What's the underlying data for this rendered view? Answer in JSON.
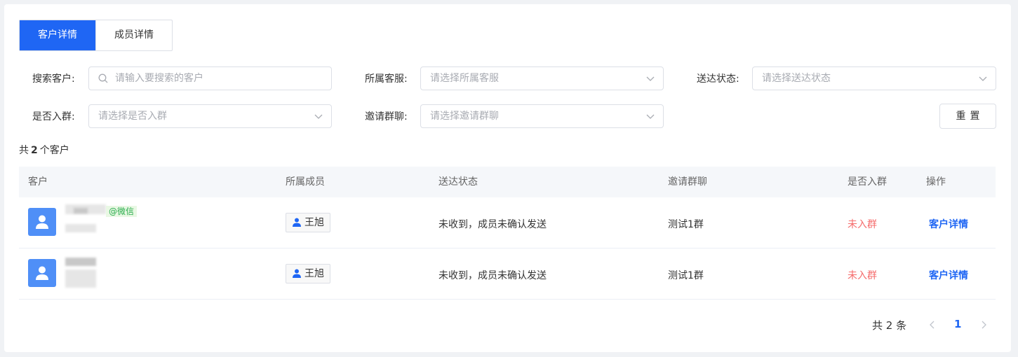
{
  "tabs": [
    {
      "label": "客户详情",
      "active": true
    },
    {
      "label": "成员详情",
      "active": false
    }
  ],
  "filters": {
    "search_customer": {
      "label": "搜索客户:",
      "placeholder": "请输入要搜索的客户"
    },
    "service_staff": {
      "label": "所属客服:",
      "placeholder": "请选择所属客服"
    },
    "delivery_status": {
      "label": "送达状态:",
      "placeholder": "请选择送达状态"
    },
    "joined_group": {
      "label": "是否入群:",
      "placeholder": "请选择是否入群"
    },
    "invite_group": {
      "label": "邀请群聊:",
      "placeholder": "请选择邀请群聊"
    },
    "reset_label": "重置"
  },
  "summary": {
    "prefix": "共",
    "count": "2",
    "suffix": "个客户"
  },
  "table": {
    "columns": [
      "客户",
      "所属成员",
      "送达状态",
      "邀请群聊",
      "是否入群",
      "操作"
    ],
    "rows": [
      {
        "wechat_tag": "@微信",
        "member": "王旭",
        "status": "未收到，成员未确认发送",
        "group": "测试1群",
        "joined": "未入群",
        "action": "客户详情"
      },
      {
        "wechat_tag": "",
        "member": "王旭",
        "status": "未收到，成员未确认发送",
        "group": "测试1群",
        "joined": "未入群",
        "action": "客户详情"
      }
    ]
  },
  "pagination": {
    "total_text": "共 2 条",
    "current_page": "1"
  },
  "colors": {
    "primary": "#1f66f4",
    "danger": "#f56c6c",
    "avatar": "#4f8ff7",
    "wechat": "#2bad4e"
  },
  "icons": [
    "search-icon",
    "chevron-down-icon",
    "user-icon",
    "avatar-person-icon",
    "chevron-left-icon",
    "chevron-right-icon"
  ]
}
